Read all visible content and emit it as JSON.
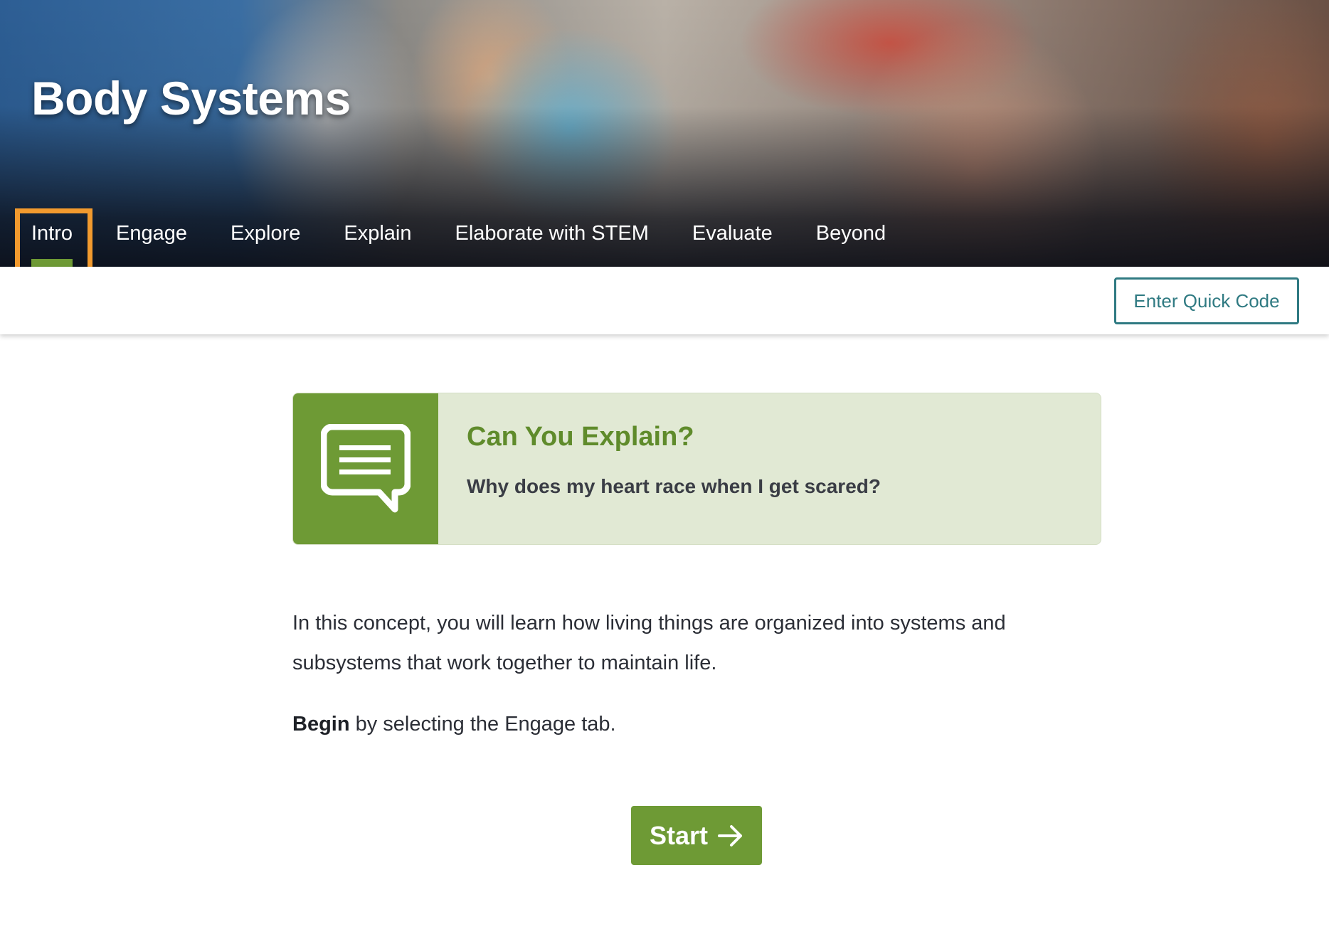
{
  "header": {
    "title": "Body Systems"
  },
  "tabs": [
    {
      "label": "Intro",
      "active": true
    },
    {
      "label": "Engage",
      "active": false
    },
    {
      "label": "Explore",
      "active": false
    },
    {
      "label": "Explain",
      "active": false
    },
    {
      "label": "Elaborate with STEM",
      "active": false
    },
    {
      "label": "Evaluate",
      "active": false
    },
    {
      "label": "Beyond",
      "active": false
    }
  ],
  "toolbar": {
    "quick_code_label": "Enter Quick Code"
  },
  "callout": {
    "icon": "speech-bubble-icon",
    "title": "Can You Explain?",
    "question": "Why does my heart race when I get scared?"
  },
  "content": {
    "intro": "In this concept, you will learn how living things are organized into systems and subsystems that work together to maintain life.",
    "begin_bold": "Begin",
    "begin_rest": " by selecting the Engage tab."
  },
  "start_button": {
    "label": "Start",
    "icon": "arrow-right-icon"
  },
  "colors": {
    "accent_green": "#6e9a35",
    "callout_bg": "#e1e9d4",
    "teal": "#2f7a82",
    "focus_orange": "#f29a2e"
  }
}
